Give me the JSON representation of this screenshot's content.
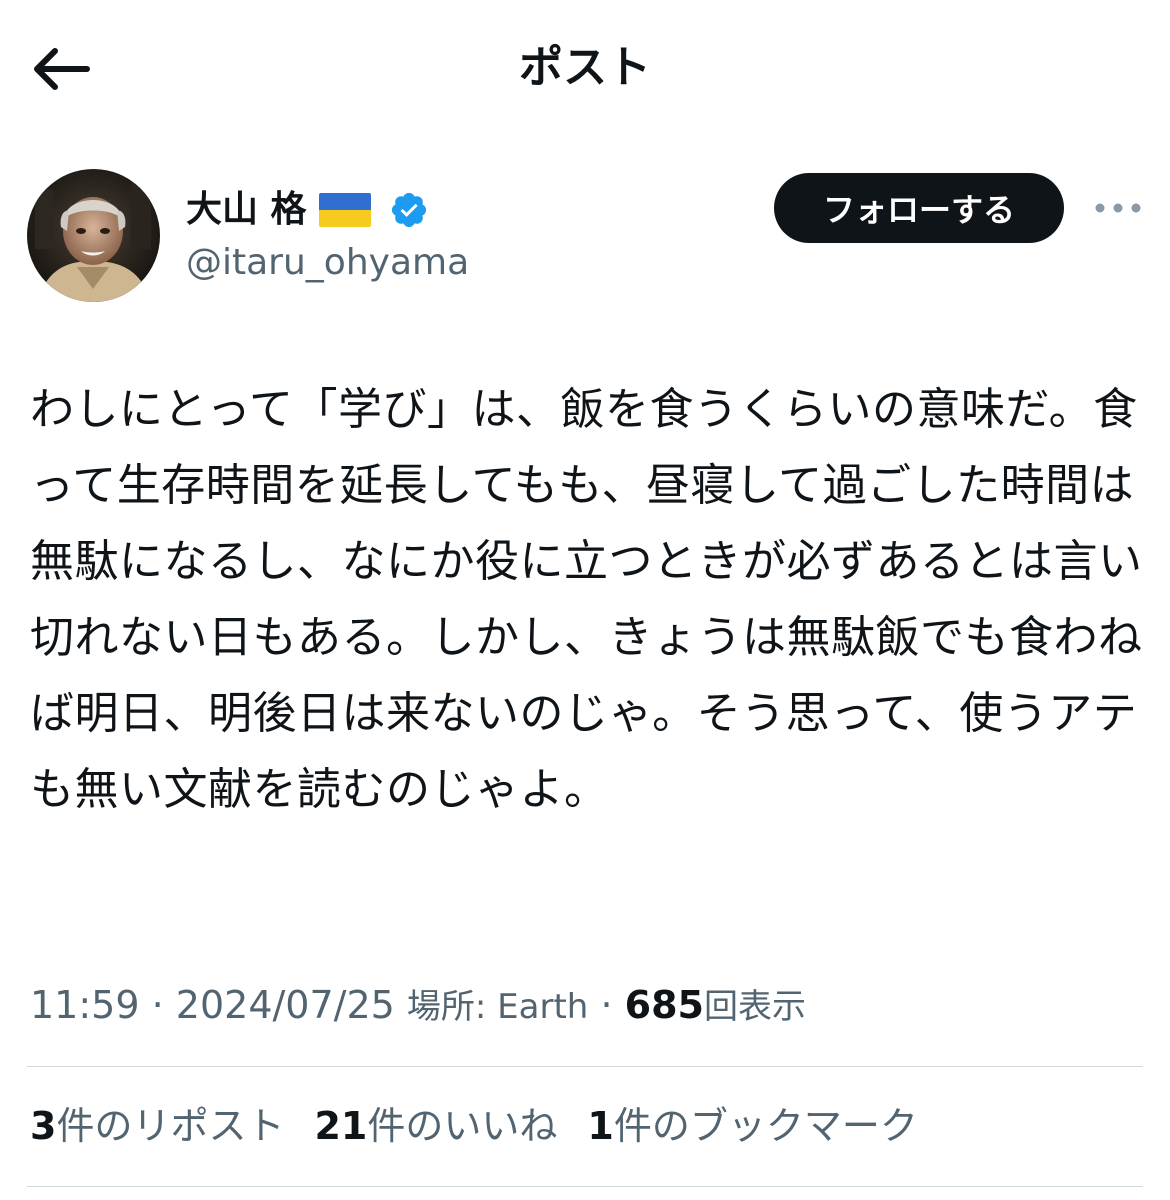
{
  "header": {
    "title": "ポスト",
    "back_icon": "arrow-left-icon"
  },
  "author": {
    "name": "大山 格",
    "flag": "ukraine-flag",
    "verified_icon": "verified-badge-icon",
    "handle": "@itaru_ohyama",
    "follow_label": "フォローする",
    "more_icon": "more-horizontal-icon"
  },
  "post": {
    "text": "わしにとって「学び」は、飯を食うくらいの意味だ。食って生存時間を延長してもも、昼寝して過ごした時間は無駄になるし、なにか役に立つときが必ずあるとは言い切れない日もある。しかし、きょうは無駄飯でも食わねば明日、明後日は来ないのじゃ。そう思って、使うアテも無い文献を読むのじゃよ。"
  },
  "meta": {
    "time": "11:59",
    "sep1": "·",
    "date": "2024/07/25",
    "location_label": "場所: Earth",
    "sep2": "·",
    "views_count": "685",
    "views_label": "回表示"
  },
  "stats": {
    "reposts_count": "3",
    "reposts_label": "件のリポスト",
    "likes_count": "21",
    "likes_label": "件のいいね",
    "bookmarks_count": "1",
    "bookmarks_label": "件のブックマーク"
  },
  "colors": {
    "text_primary": "#0f1419",
    "text_secondary": "#536471",
    "verified_blue": "#1d9bf0",
    "divider": "#cfd9de",
    "flag_blue": "#2f6fcf",
    "flag_yellow": "#f5cc1e"
  }
}
